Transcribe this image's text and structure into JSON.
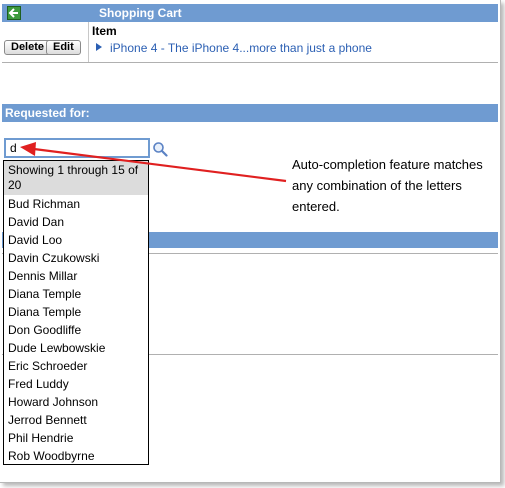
{
  "cart": {
    "title": "Shopping Cart",
    "column_item": "Item",
    "delete_label": "Delete",
    "edit_label": "Edit",
    "item_text": "iPhone 4 - The iPhone 4...more than just a phone"
  },
  "requested_for": {
    "heading": "Requested for:",
    "input_value": "d"
  },
  "dropdown": {
    "header": "Showing 1 through 15 of 20",
    "options": [
      "Bud Richman",
      "David Dan",
      "David Loo",
      "Davin Czukowski",
      "Dennis Millar",
      "Diana Temple",
      "Diana Temple",
      "Don Goodliffe",
      "Dude Lewbowskie",
      "Eric Schroeder",
      "Fred Luddy",
      "Howard Johnson",
      "Jerrod Bennett",
      "Phil Hendrie",
      "Rob Woodbyrne"
    ]
  },
  "annotation": {
    "text": "Auto-completion feature matches any combination of the letters entered."
  },
  "colors": {
    "header_bar": "#6f9bd1",
    "link": "#2b5fb3",
    "callout_arrow": "#e02020",
    "back_button": "#3c9a3c"
  },
  "icons": {
    "back": "back-arrow-icon",
    "search": "magnifier-icon",
    "item": "triangle-bullet-icon"
  }
}
